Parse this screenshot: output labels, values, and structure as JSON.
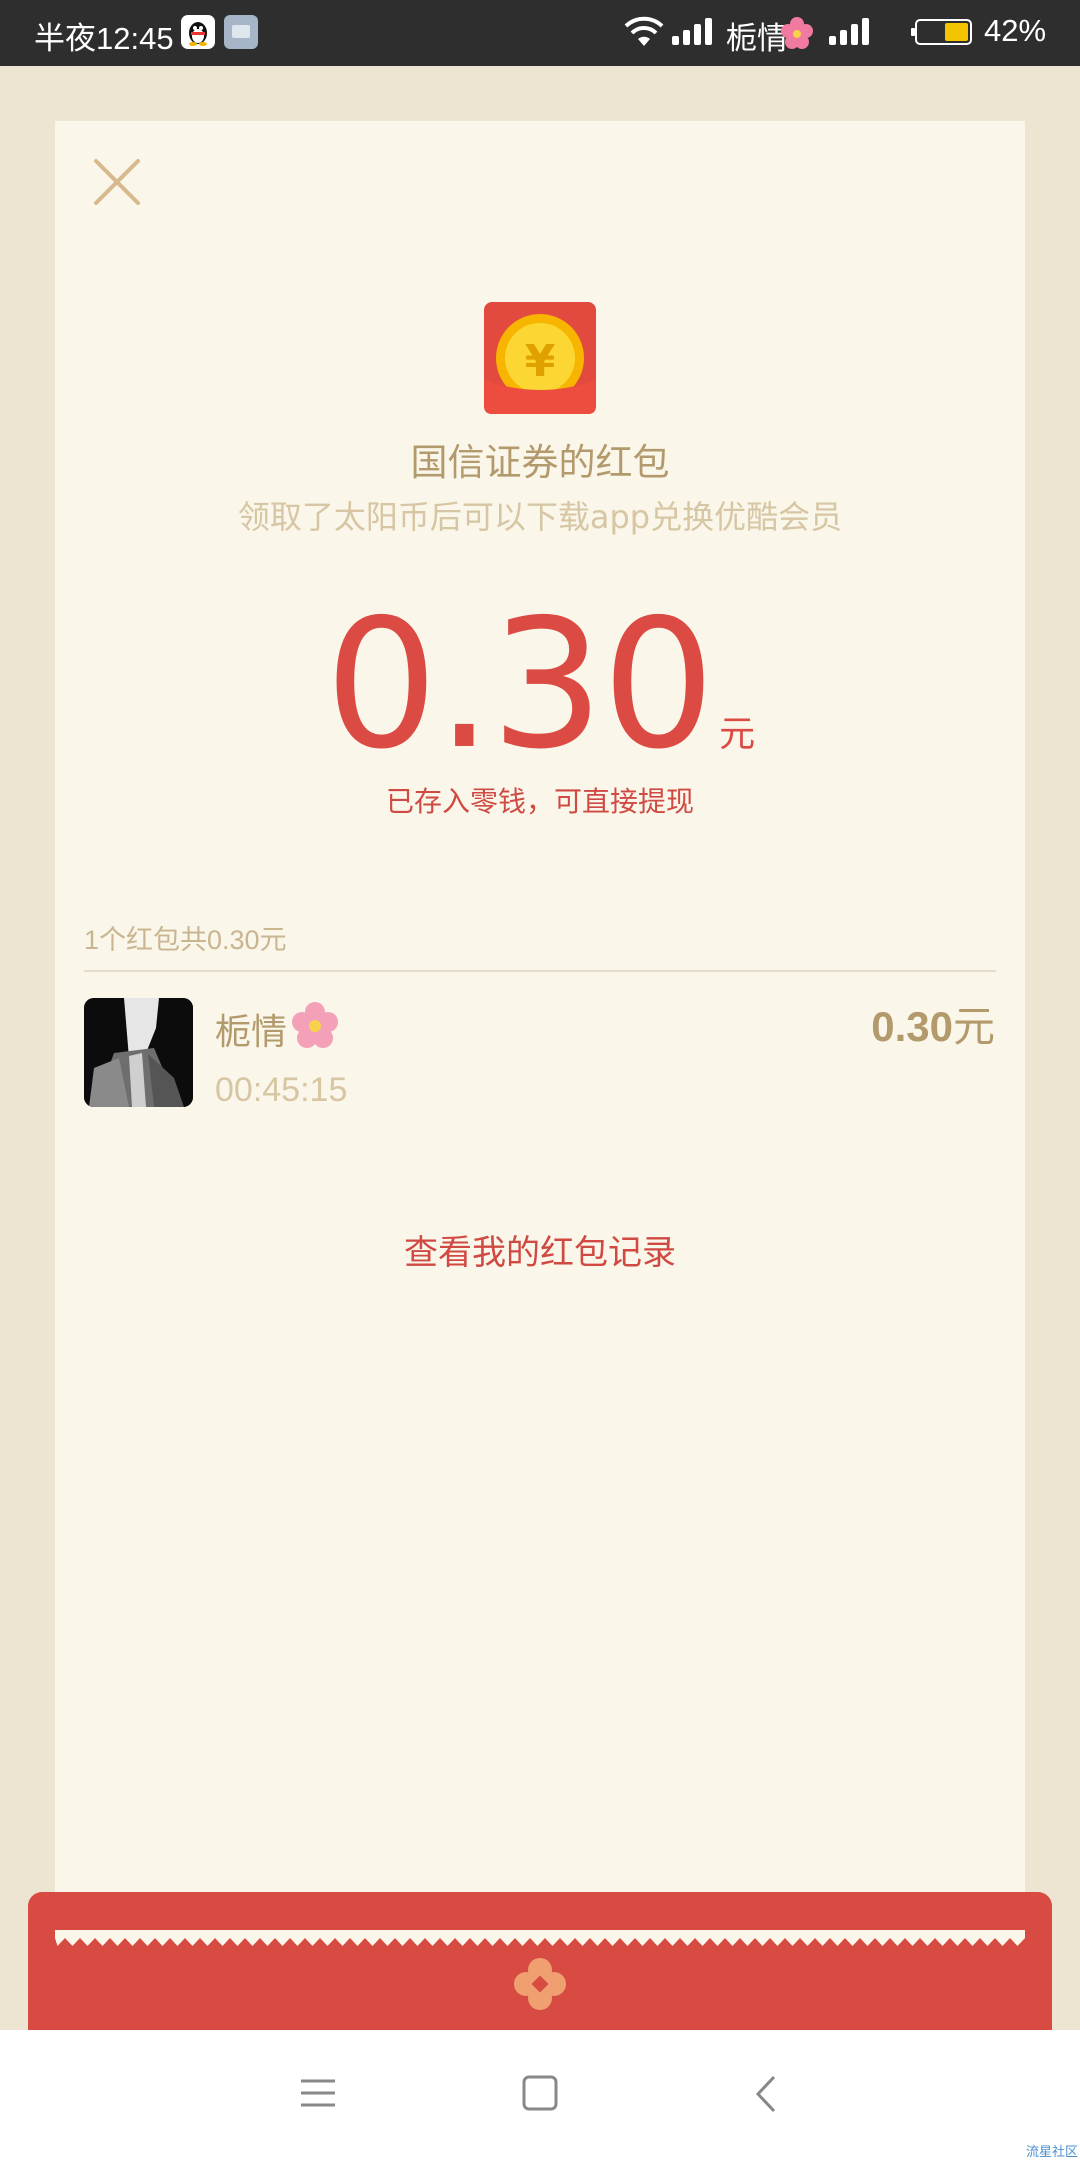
{
  "status_bar": {
    "time": "半夜12:45",
    "carrier": "栀情",
    "battery": "42%",
    "icons": [
      "qq-icon",
      "app-icon",
      "wifi-icon",
      "signal-icon",
      "flower-icon",
      "signal-icon",
      "battery-icon"
    ]
  },
  "packet": {
    "title": "国信证券的红包",
    "subtitle": "领取了太阳币后可以下载app兑换优酷会员",
    "amount": "0.30",
    "unit": "元",
    "note": "已存入零钱，可直接提现"
  },
  "summary": "1个红包共0.30元",
  "receivers": [
    {
      "name": "栀情",
      "time": "00:45:15",
      "amount": "0.30",
      "unit": "元"
    }
  ],
  "records_link": "查看我的红包记录",
  "watermark": "流星社区",
  "colors": {
    "accent_red": "#db4b44",
    "gold_text": "#b39a6c",
    "card_bg": "#faf6ea",
    "page_bg": "#ede4d2"
  }
}
